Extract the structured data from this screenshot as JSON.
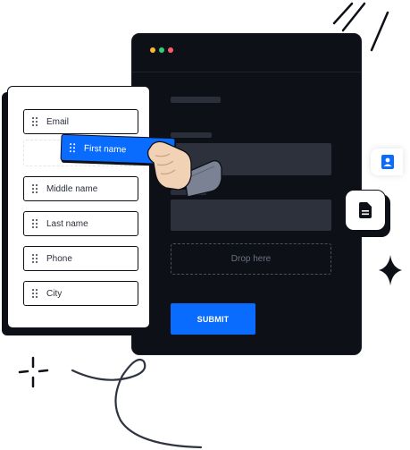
{
  "window": {
    "dots": [
      "#fbb731",
      "#2fd07c",
      "#ff5c6a"
    ]
  },
  "canvas": {
    "dropzone_label": "Drop here",
    "submit_label": "SUBMIT"
  },
  "palette": {
    "fields": [
      {
        "label": "Email"
      },
      {
        "label": "Middle name"
      },
      {
        "label": "Last name"
      },
      {
        "label": "Phone"
      },
      {
        "label": "City"
      }
    ],
    "dragged_field": {
      "label": "First name"
    }
  },
  "colors": {
    "accent": "#0a6cff",
    "dark": "#0d1017"
  },
  "icons": {
    "side_icon_1": "contact-card-icon",
    "side_icon_2": "document-icon",
    "cursor": "grabbing-hand-icon"
  }
}
